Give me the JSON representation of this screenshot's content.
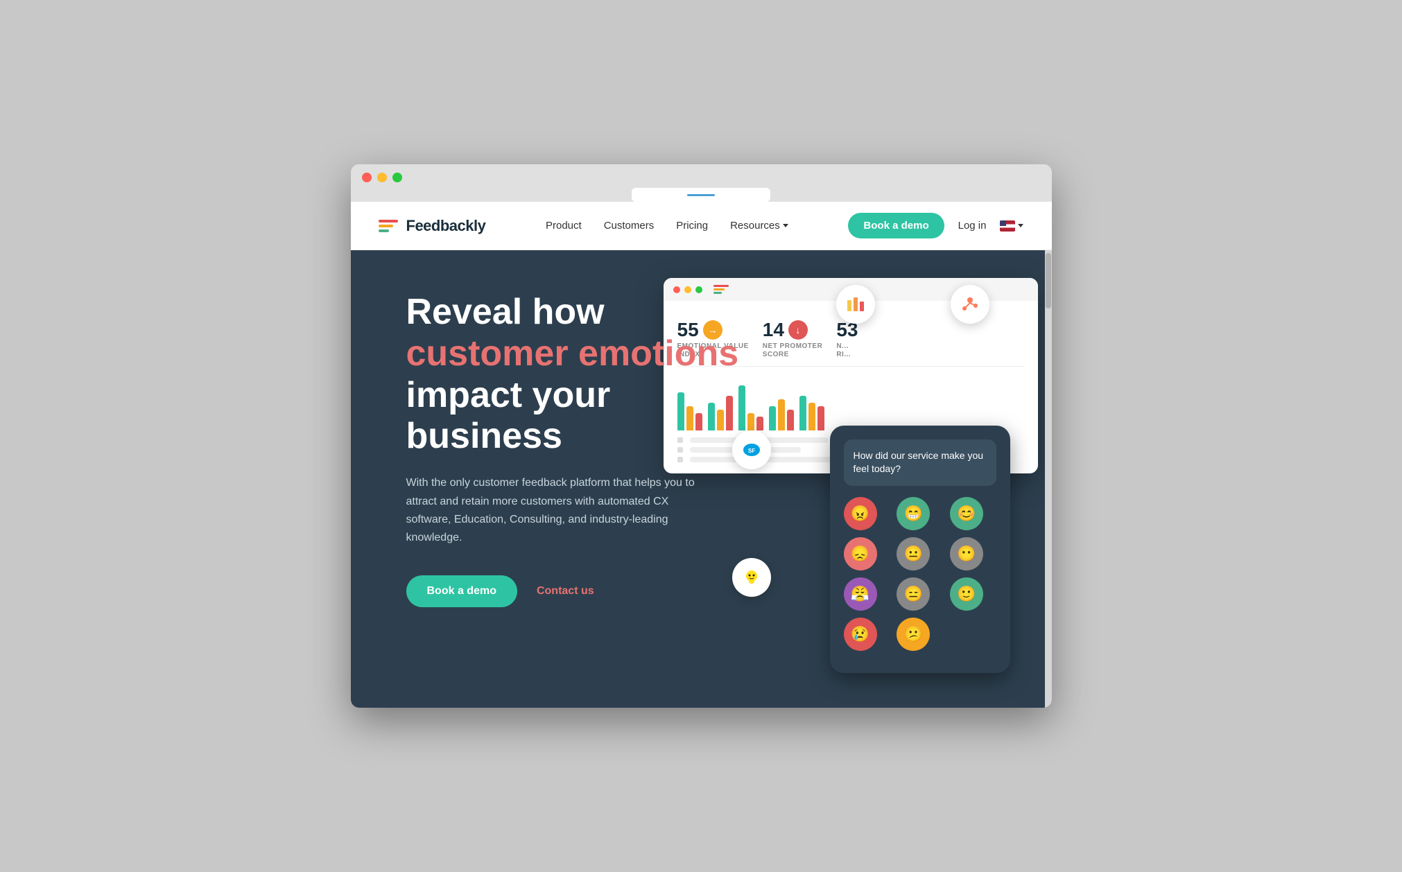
{
  "browser": {
    "traffic_lights": [
      "close",
      "minimize",
      "maximize"
    ]
  },
  "navbar": {
    "logo_text": "Feedbackly",
    "links": [
      {
        "label": "Product",
        "id": "product"
      },
      {
        "label": "Customers",
        "id": "customers"
      },
      {
        "label": "Pricing",
        "id": "pricing"
      },
      {
        "label": "Resources",
        "id": "resources",
        "has_dropdown": true
      }
    ],
    "book_demo": "Book a demo",
    "login": "Log in"
  },
  "hero": {
    "title_line1": "Reveal how",
    "title_highlight": "customer emotions",
    "title_line3": "impact your",
    "title_line4": "business",
    "description": "With the only customer feedback platform that helps you to attract and retain more customers with automated CX software, Education, Consulting, and industry-leading knowledge.",
    "btn_demo": "Book a demo",
    "btn_contact": "Contact us"
  },
  "dashboard": {
    "metrics": [
      {
        "value": "55",
        "label": "EMOTIONAL VALUE\nINDEX",
        "arrow_direction": "→",
        "arrow_color": "yellow"
      },
      {
        "value": "14",
        "label": "NET PROMOTER\nSCORE",
        "arrow_direction": "↓",
        "arrow_color": "red"
      }
    ]
  },
  "phone": {
    "question": "How did our service make you feel today?",
    "emojis": [
      {
        "color": "#e05555",
        "face": "😠"
      },
      {
        "color": "#4caf88",
        "face": "😁"
      },
      {
        "color": "#4caf88",
        "face": "😊"
      },
      {
        "color": "#e87272",
        "face": "😞"
      },
      {
        "color": "#888",
        "face": "😐"
      },
      {
        "color": "#888",
        "face": "😶"
      },
      {
        "color": "#9b59b6",
        "face": "😠"
      },
      {
        "color": "#888",
        "face": "😑"
      },
      {
        "color": "#4caf88",
        "face": "🙂"
      },
      {
        "color": "#e05555",
        "face": "😢"
      },
      {
        "color": "#f5a623",
        "face": "😕"
      }
    ]
  },
  "chart_bars": [
    {
      "teal": 55,
      "yellow": 35,
      "red": 25
    },
    {
      "teal": 40,
      "yellow": 30,
      "red": 50
    },
    {
      "teal": 65,
      "yellow": 25,
      "red": 20
    },
    {
      "teal": 35,
      "yellow": 45,
      "red": 30
    },
    {
      "teal": 50,
      "yellow": 40,
      "red": 35
    }
  ]
}
